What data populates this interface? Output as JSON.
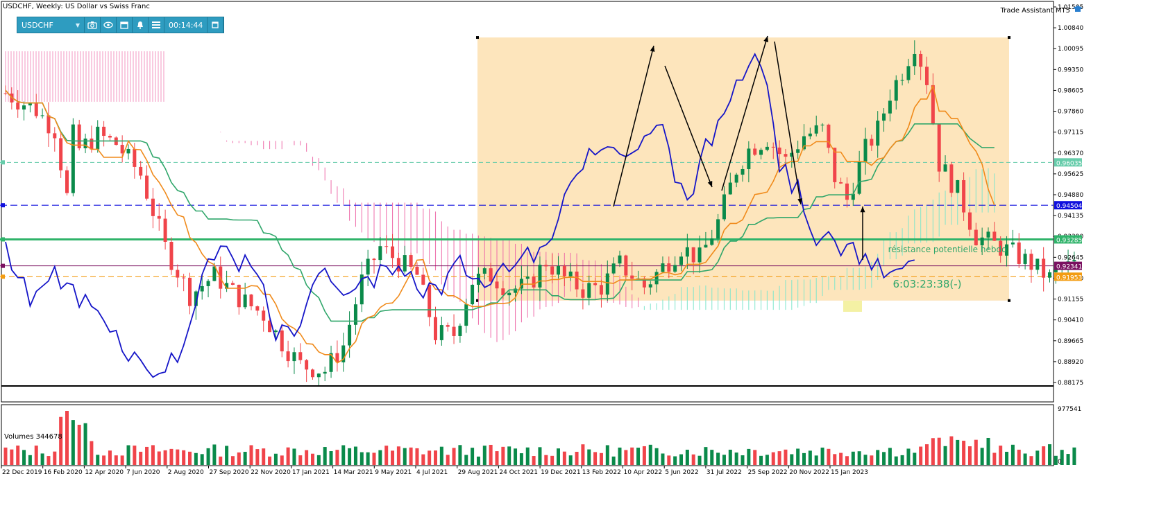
{
  "header": {
    "title": "USDCHF, Weekly:  US Dollar vs Swiss Franc",
    "assistant": "Trade Assistant MT5"
  },
  "toolbar": {
    "symbol": "USDCHF",
    "timer": "00:14:44",
    "icons": [
      "camera-icon",
      "eye-icon",
      "calendar-icon",
      "bell-icon",
      "menu-icon",
      "window-icon"
    ]
  },
  "price_axis": [
    "1.01585",
    "1.00840",
    "1.00095",
    "0.99350",
    "0.98605",
    "0.97860",
    "0.97115",
    "0.96370",
    "0.95625",
    "0.94880",
    "0.94135",
    "0.93390",
    "0.92645",
    "0.91900",
    "0.91155",
    "0.90410",
    "0.89665",
    "0.88920",
    "0.88175"
  ],
  "price_tags": [
    {
      "label": "0.96035",
      "color": "#66ccaa"
    },
    {
      "label": "0.94504",
      "color": "#1010dd"
    },
    {
      "label": "0.93285",
      "color": "#2fb36a"
    },
    {
      "label": "0.92341",
      "color": "#7a1060"
    },
    {
      "label": "0.91953",
      "color": "#f39c12"
    }
  ],
  "date_axis": [
    "22 Dec 2019",
    "16 Feb 2020",
    "12 Apr 2020",
    "7 Jun 2020",
    "2 Aug 2020",
    "27 Sep 2020",
    "22 Nov 2020",
    "17 Jan 2021",
    "14 Mar 2021",
    "9 May 2021",
    "4 Jul 2021",
    "29 Aug 2021",
    "24 Oct 2021",
    "19 Dec 2021",
    "13 Feb 2022",
    "10 Apr 2022",
    "5 Jun 2022",
    "31 Jul 2022",
    "25 Sep 2022",
    "20 Nov 2022",
    "15 Jan 2023"
  ],
  "annotations": {
    "resistance": "résistance potentielle hebdo",
    "countdown": "6:03:23:38(-)"
  },
  "volume": {
    "label": "Volumes 344678",
    "axis_top": "977541",
    "axis_bottom": "0"
  },
  "colors": {
    "bull": "#0a8a4a",
    "bear": "#f0444a",
    "tenkan": "#f08a1a",
    "kijun": "#2fa66a",
    "chikou": "#1515c8",
    "rect": "#fde0b0",
    "cloud_pink": "#ee6aa8",
    "cloud_teal": "#7ee6cc"
  }
}
